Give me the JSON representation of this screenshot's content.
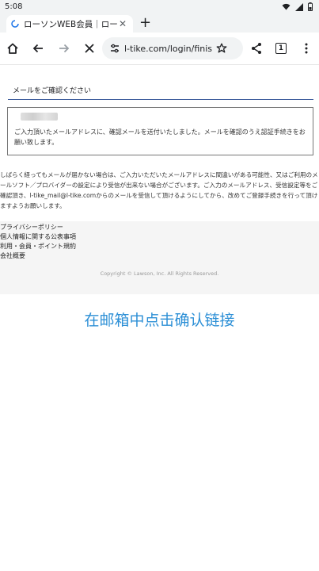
{
  "status": {
    "time": "5:08"
  },
  "tab": {
    "title": "ローソンWEB会員｜ローソンチケット"
  },
  "omnibox": {
    "url": "l-tike.com/login/finish/"
  },
  "toolbar": {
    "tab_count": "1"
  },
  "page": {
    "heading": "メールをご確認ください",
    "message": "ご入力頂いたメールアドレスに、確認メールを送付いたしました。メールを確認のうえ認証手続きをお願い致します。",
    "notice": "しばらく経ってもメールが届かない場合は、ご入力いただいたメールアドレスに間違いがある可能性、又はご利用のメールソフト／プロバイダーの設定により受信が出来ない場合がございます。ご入力のメールアドレス、受信設定等をご確認頂き、l-tike_mail@l-tike.comからのメールを受信して頂けるようにしてから、改めてご登録手続きを行って頂けますようお願いします。"
  },
  "footer": {
    "links": [
      "プライバシーポリシー",
      "個人情報に関する公表事項",
      "利用・会員・ポイント規約",
      "会社概要"
    ],
    "copyright": "Copyright © Lawson, Inc. All Rights Reserved."
  },
  "overlay": {
    "instruction": "在邮箱中点击确认链接"
  },
  "colors": {
    "accent": "#2c8fd6",
    "rule": "#3a5a9a"
  },
  "icons": [
    "wifi-icon",
    "signal-icon",
    "battery-icon",
    "loading-spinner-icon",
    "close-icon",
    "plus-icon",
    "home-icon",
    "back-arrow-icon",
    "forward-arrow-icon",
    "stop-icon",
    "site-settings-icon",
    "star-icon",
    "share-icon",
    "menu-icon"
  ]
}
